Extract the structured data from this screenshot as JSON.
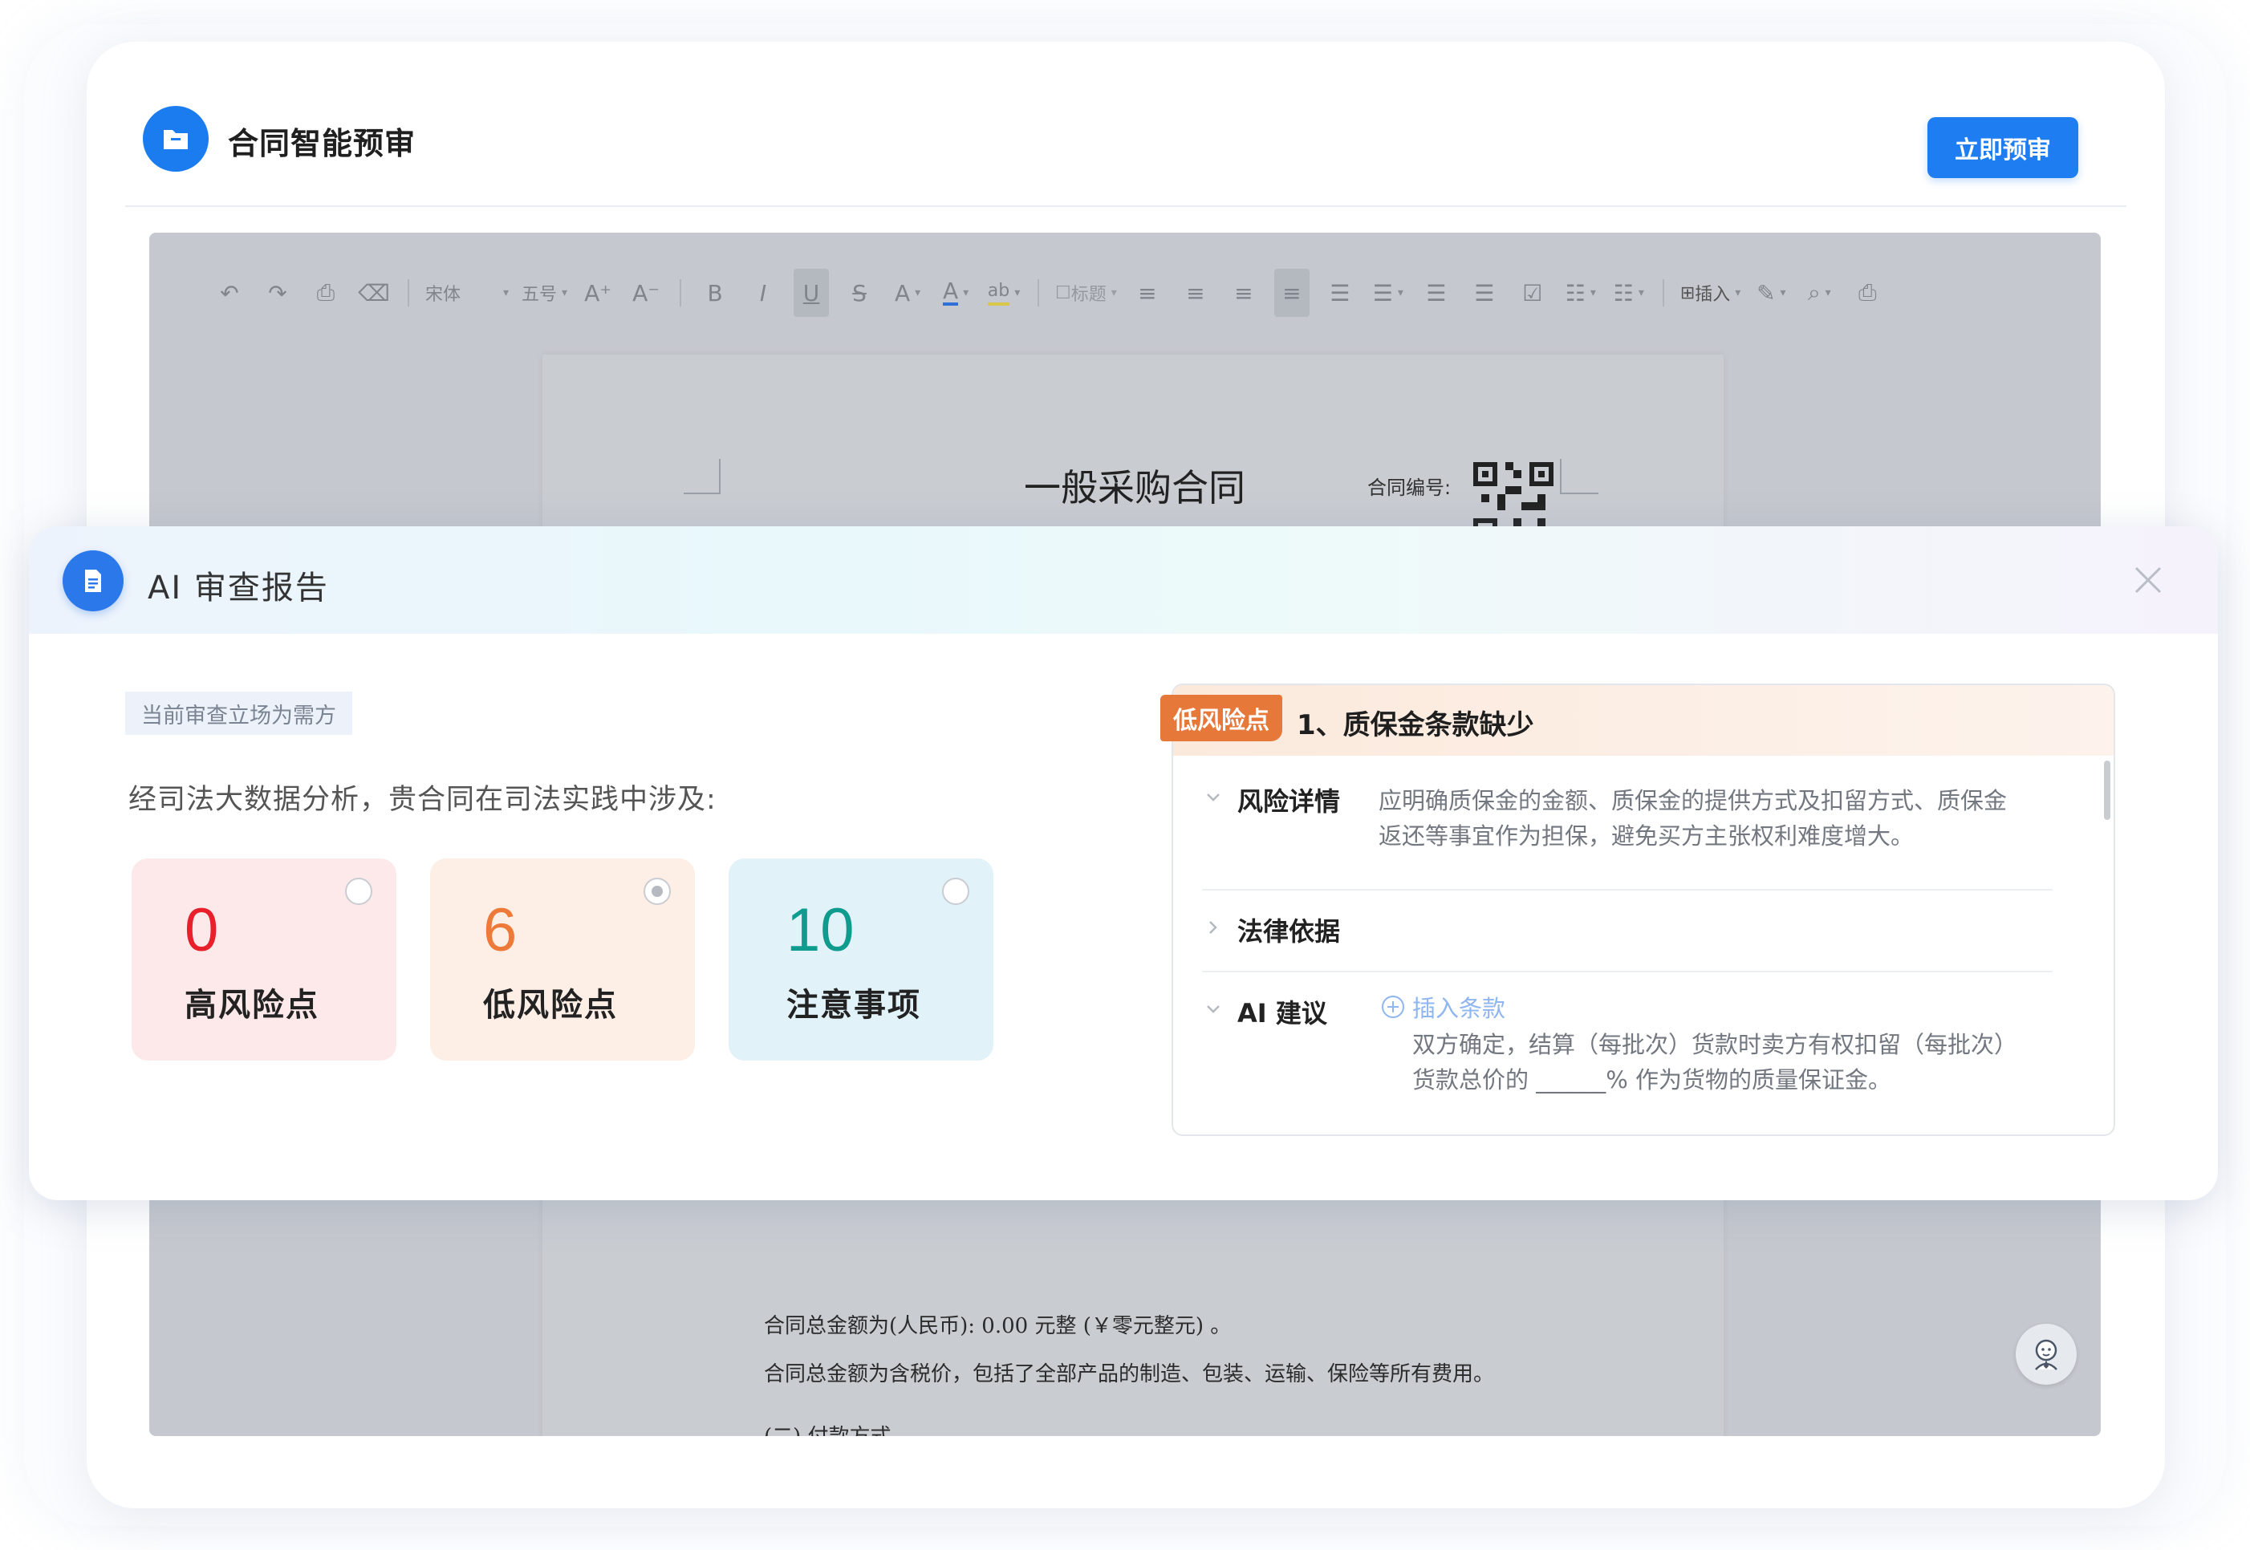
{
  "header": {
    "title": "合同智能预审",
    "preview_button": "立即预审"
  },
  "toolbar": {
    "font_family": "宋体",
    "font_size": "五号",
    "grow_font": "A⁺",
    "shrink_font": "A⁻",
    "bold": "B",
    "italic": "I",
    "underline": "U",
    "strike": "S",
    "text_style": "A",
    "font_color": "A",
    "highlight": "ab",
    "heading": "标题",
    "insert": "插入"
  },
  "document": {
    "title": "一般采购合同",
    "contract_no_label": "合同编号:",
    "lines": [
      "合同总金额为(人民币): 0.00 元整 (￥零元整元) 。",
      "合同总金额为含税价，包括了全部产品的制造、包装、运输、保险等所有费用。",
      "(二) 付款方式"
    ]
  },
  "report": {
    "title": "AI 审查报告",
    "stance": "当前审查立场为需方",
    "analysis": "经司法大数据分析，贵合同在司法实践中涉及:",
    "stats": [
      {
        "value": "0",
        "label": "高风险点",
        "color": "#e8202b",
        "bg": "#fde9ea",
        "selected": false
      },
      {
        "value": "6",
        "label": "低风险点",
        "color": "#ee7a3a",
        "bg": "#fdefe6",
        "selected": true
      },
      {
        "value": "10",
        "label": "注意事项",
        "color": "#0f9b8e",
        "bg": "#e1f2f8",
        "selected": false
      }
    ],
    "risk": {
      "badge": "低风险点",
      "title": "1、质保金条款缺少",
      "detail_label": "风险详情",
      "detail_lines": [
        "应明确质保金的金额、质保金的提供方式及扣留方式、质保金",
        "返还等事宜作为担保，避免买方主张权利难度增大。"
      ],
      "basis_label": "法律依据",
      "advice_label": "AI 建议",
      "insert_label": "插入条款",
      "advice_lines": [
        "双方确定，结算（每批次）货款时卖方有权扣留（每批次）",
        "货款总价的 ______% 作为货物的质量保证金。"
      ]
    }
  },
  "colors": {
    "primary": "#1e7ef1",
    "risk_badge": "#e6783a"
  }
}
